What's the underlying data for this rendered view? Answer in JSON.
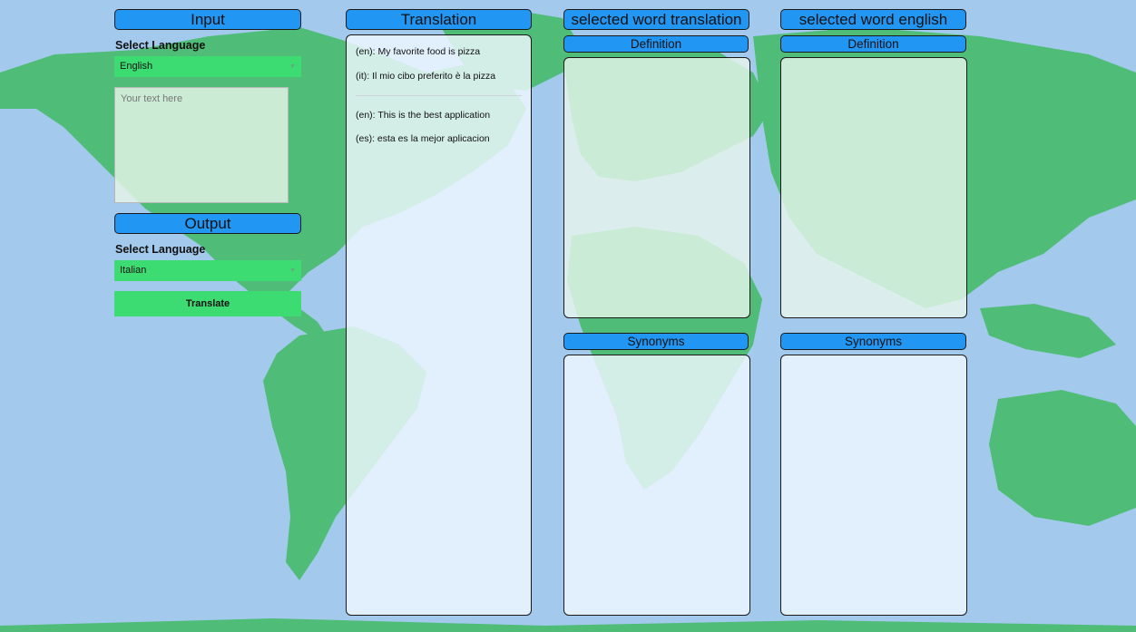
{
  "input_panel": {
    "header": "Input",
    "select_label": "Select Language",
    "language": "English",
    "textarea_placeholder": "Your text here"
  },
  "output_panel": {
    "header": "Output",
    "select_label": "Select Language",
    "language": "Italian",
    "translate_button": "Translate"
  },
  "translation_panel": {
    "header": "Translation",
    "entries": [
      {
        "text": "(en): My favorite food is pizza"
      },
      {
        "text": "(it): Il mio cibo preferito è la pizza"
      },
      {
        "text": "(en): This is the best application"
      },
      {
        "text": "(es): esta es la mejor aplicacion"
      }
    ]
  },
  "selected_word_translation": {
    "header": "selected word translation",
    "definition_header": "Definition",
    "synonyms_header": "Synonyms"
  },
  "selected_word_english": {
    "header": "selected word english",
    "definition_header": "Definition",
    "synonyms_header": "Synonyms"
  },
  "colors": {
    "accent_blue": "#2196f3",
    "accent_green": "#3ddc73",
    "ocean": "#a3c9ec",
    "land": "#4fbd78"
  },
  "icons": {
    "select_caret": "▼"
  }
}
